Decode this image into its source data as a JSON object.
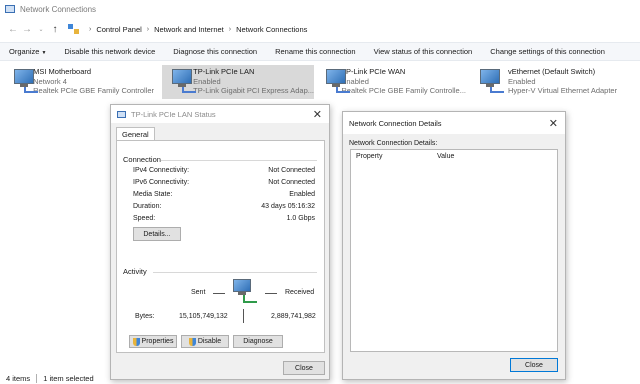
{
  "window": {
    "title": "Network Connections"
  },
  "breadcrumb": [
    "Control Panel",
    "Network and Internet",
    "Network Connections"
  ],
  "toolbar": {
    "organize": "Organize",
    "disable": "Disable this network device",
    "diagnose": "Diagnose this connection",
    "rename": "Rename this connection",
    "view_status": "View status of this connection",
    "change_settings": "Change settings of this connection"
  },
  "adapters": [
    {
      "name": "MSI Motherboard",
      "status": "Network 4",
      "device": "Realtek PCIe GBE Family Controller"
    },
    {
      "name": "TP-Link PCIe LAN",
      "status": "Enabled",
      "device": "TP-Link Gigabit PCI Express Adap..."
    },
    {
      "name": "TP-Link PCIe WAN",
      "status": "Enabled",
      "device": "Realtek PCIe GBE Family Controlle..."
    },
    {
      "name": "vEthernet (Default Switch)",
      "status": "Enabled",
      "device": "Hyper-V Virtual Ethernet Adapter"
    }
  ],
  "status_dialog": {
    "title": "TP-Link PCIe LAN Status",
    "tab": "General",
    "connection_label": "Connection",
    "ipv4_label": "IPv4 Connectivity:",
    "ipv4_value": "Not Connected",
    "ipv6_label": "IPv6 Connectivity:",
    "ipv6_value": "Not Connected",
    "media_label": "Media State:",
    "media_value": "Enabled",
    "duration_label": "Duration:",
    "duration_value": "43 days 05:16:32",
    "speed_label": "Speed:",
    "speed_value": "1.0 Gbps",
    "details_button": "Details...",
    "activity_label": "Activity",
    "sent_label": "Sent",
    "received_label": "Received",
    "bytes_label": "Bytes:",
    "bytes_sent": "15,105,749,132",
    "bytes_received": "2,889,741,982",
    "properties_button": "Properties",
    "disable_button": "Disable",
    "diagnose_button": "Diagnose",
    "close_button": "Close"
  },
  "details_dialog": {
    "title": "Network Connection Details",
    "section_label": "Network Connection Details:",
    "col_property": "Property",
    "col_value": "Value",
    "close_button": "Close"
  },
  "statusbar": {
    "items": "4 items",
    "selected": "1 item selected"
  }
}
